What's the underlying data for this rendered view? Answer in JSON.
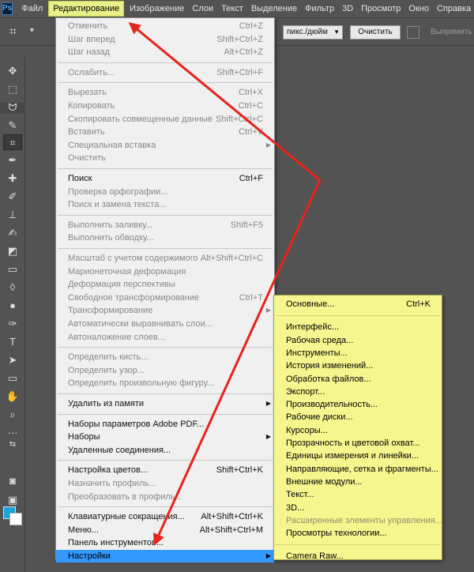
{
  "app_logo": "Ps",
  "menubar": [
    "Файл",
    "Редактирование",
    "Изображение",
    "Слои",
    "Текст",
    "Выделение",
    "Фильтр",
    "3D",
    "Просмотр",
    "Окно",
    "Справка"
  ],
  "options": {
    "units": "пикс./дюйм",
    "clear": "Очистить",
    "raise": "Выпрямить"
  },
  "edit_menu": [
    {
      "label": "Отменить",
      "shortcut": "Ctrl+Z",
      "enabled": false
    },
    {
      "label": "Шаг вперед",
      "shortcut": "Shift+Ctrl+Z",
      "enabled": false
    },
    {
      "label": "Шаг назад",
      "shortcut": "Alt+Ctrl+Z",
      "enabled": false
    },
    {
      "sep": true
    },
    {
      "label": "Ослабить...",
      "shortcut": "Shift+Ctrl+F",
      "enabled": false
    },
    {
      "sep": true
    },
    {
      "label": "Вырезать",
      "shortcut": "Ctrl+X",
      "enabled": false
    },
    {
      "label": "Копировать",
      "shortcut": "Ctrl+C",
      "enabled": false
    },
    {
      "label": "Скопировать совмещенные данные",
      "shortcut": "Shift+Ctrl+C",
      "enabled": false
    },
    {
      "label": "Вставить",
      "shortcut": "Ctrl+V",
      "enabled": false
    },
    {
      "label": "Специальная вставка",
      "shortcut": "",
      "enabled": false,
      "submenu": true
    },
    {
      "label": "Очистить",
      "shortcut": "",
      "enabled": false
    },
    {
      "sep": true
    },
    {
      "label": "Поиск",
      "shortcut": "Ctrl+F",
      "enabled": true
    },
    {
      "label": "Проверка орфографии...",
      "shortcut": "",
      "enabled": false
    },
    {
      "label": "Поиск и замена текста...",
      "shortcut": "",
      "enabled": false
    },
    {
      "sep": true
    },
    {
      "label": "Выполнить заливку...",
      "shortcut": "Shift+F5",
      "enabled": false
    },
    {
      "label": "Выполнить обводку...",
      "shortcut": "",
      "enabled": false
    },
    {
      "sep": true
    },
    {
      "label": "Масштаб с учетом содержимого",
      "shortcut": "Alt+Shift+Ctrl+C",
      "enabled": false
    },
    {
      "label": "Марионеточная деформация",
      "shortcut": "",
      "enabled": false
    },
    {
      "label": "Деформация перспективы",
      "shortcut": "",
      "enabled": false
    },
    {
      "label": "Свободное трансформирование",
      "shortcut": "Ctrl+T",
      "enabled": false
    },
    {
      "label": "Трансформирование",
      "shortcut": "",
      "enabled": false,
      "submenu": true
    },
    {
      "label": "Автоматически выравнивать слои...",
      "shortcut": "",
      "enabled": false
    },
    {
      "label": "Автоналожение слоев...",
      "shortcut": "",
      "enabled": false
    },
    {
      "sep": true
    },
    {
      "label": "Определить кисть...",
      "shortcut": "",
      "enabled": false
    },
    {
      "label": "Определить узор...",
      "shortcut": "",
      "enabled": false
    },
    {
      "label": "Определить произвольную фигуру...",
      "shortcut": "",
      "enabled": false
    },
    {
      "sep": true
    },
    {
      "label": "Удалить из памяти",
      "shortcut": "",
      "enabled": true,
      "submenu": true
    },
    {
      "sep": true
    },
    {
      "label": "Наборы параметров Adobe PDF...",
      "shortcut": "",
      "enabled": true
    },
    {
      "label": "Наборы",
      "shortcut": "",
      "enabled": true,
      "submenu": true
    },
    {
      "label": "Удаленные соединения...",
      "shortcut": "",
      "enabled": true
    },
    {
      "sep": true
    },
    {
      "label": "Настройка цветов...",
      "shortcut": "Shift+Ctrl+K",
      "enabled": true
    },
    {
      "label": "Назначить профиль...",
      "shortcut": "",
      "enabled": false
    },
    {
      "label": "Преобразовать в профиль...",
      "shortcut": "",
      "enabled": false
    },
    {
      "sep": true
    },
    {
      "label": "Клавиатурные сокращения...",
      "shortcut": "Alt+Shift+Ctrl+K",
      "enabled": true
    },
    {
      "label": "Меню...",
      "shortcut": "Alt+Shift+Ctrl+M",
      "enabled": true
    },
    {
      "label": "Панель инструментов...",
      "shortcut": "",
      "enabled": true
    },
    {
      "label": "Настройки",
      "shortcut": "",
      "enabled": true,
      "submenu": true,
      "highlighted": true
    }
  ],
  "prefs_menu": [
    {
      "label": "Основные...",
      "shortcut": "Ctrl+K",
      "enabled": true
    },
    {
      "sep": true
    },
    {
      "label": "Интерфейс...",
      "enabled": true
    },
    {
      "label": "Рабочая среда...",
      "enabled": true
    },
    {
      "label": "Инструменты...",
      "enabled": true
    },
    {
      "label": "История изменений...",
      "enabled": true
    },
    {
      "label": "Обработка файлов...",
      "enabled": true
    },
    {
      "label": "Экспорт...",
      "enabled": true
    },
    {
      "label": "Производительность...",
      "enabled": true
    },
    {
      "label": "Рабочие диски...",
      "enabled": true
    },
    {
      "label": "Курсоры...",
      "enabled": true
    },
    {
      "label": "Прозрачность и цветовой охват...",
      "enabled": true
    },
    {
      "label": "Единицы измерения и линейки...",
      "enabled": true
    },
    {
      "label": "Направляющие, сетка и фрагменты...",
      "enabled": true
    },
    {
      "label": "Внешние модули...",
      "enabled": true
    },
    {
      "label": "Текст...",
      "enabled": true
    },
    {
      "label": "3D...",
      "enabled": true
    },
    {
      "label": "Расширенные элементы управления...",
      "enabled": false
    },
    {
      "label": "Просмотры технологии...",
      "enabled": true
    },
    {
      "sep": true
    },
    {
      "label": "Camera Raw...",
      "enabled": true
    }
  ],
  "colors": {
    "foreground": "#19a5d8",
    "background": "#ffffff",
    "annotation": "#e8231c"
  }
}
